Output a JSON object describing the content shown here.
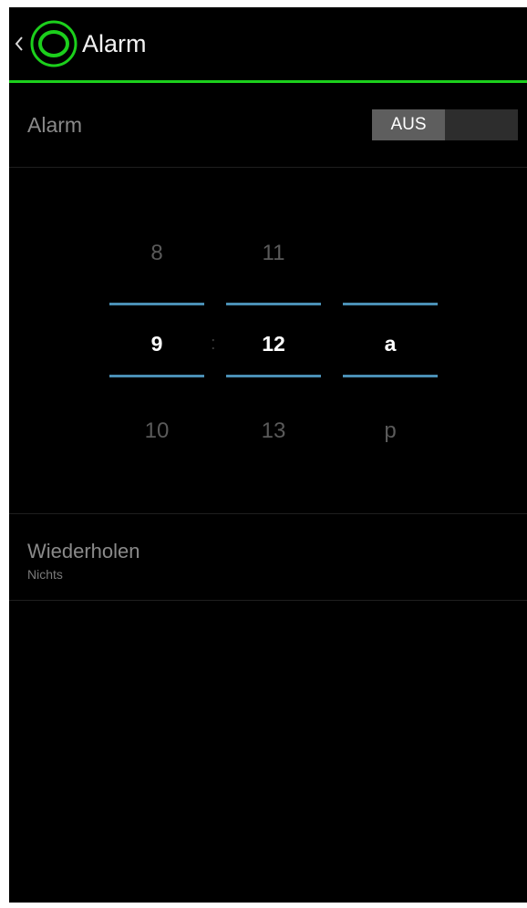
{
  "colors": {
    "accent": "#1ccf1c",
    "picker_line": "#4a8fb5",
    "background": "#000000"
  },
  "action_bar": {
    "title": "Alarm",
    "back_icon": "chevron-left-icon",
    "app_icon": "ring-icon"
  },
  "alarm_setting": {
    "label": "Alarm",
    "toggle_label": "AUS"
  },
  "time_picker": {
    "hour": {
      "prev": "8",
      "current": "9",
      "next": "10"
    },
    "separator": ":",
    "minute": {
      "prev": "11",
      "current": "12",
      "next": "13"
    },
    "ampm": {
      "prev": "",
      "current": "a",
      "next": "p"
    }
  },
  "repeat": {
    "title": "Wiederholen",
    "value": "Nichts"
  }
}
